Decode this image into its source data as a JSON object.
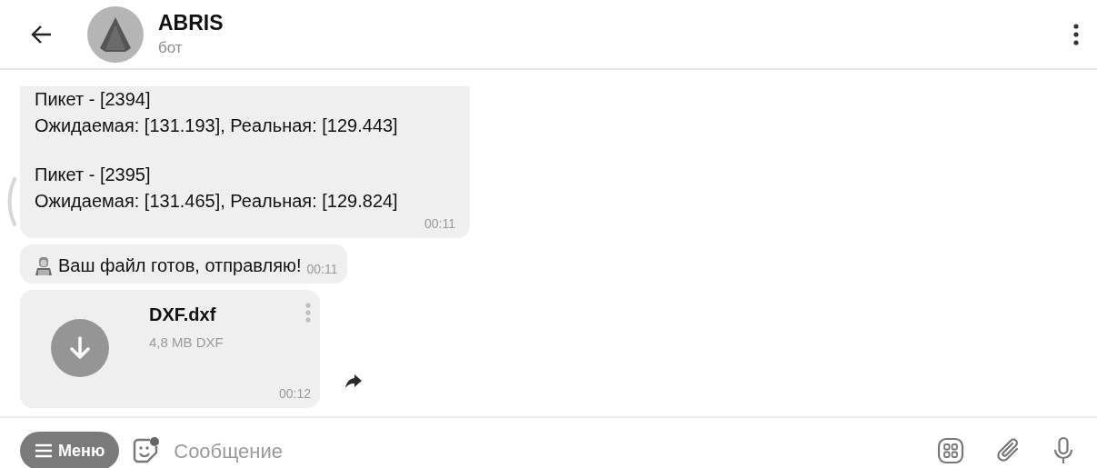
{
  "header": {
    "title": "ABRIS",
    "subtitle": "бот"
  },
  "messages": [
    {
      "kind": "text",
      "paragraphs": [
        "Пикет - [2394]\nОжидаемая: [131.193], Реальная: [129.443]",
        "Пикет - [2395]\nОжидаемая: [131.465], Реальная: [129.824]"
      ],
      "time": "00:11"
    },
    {
      "kind": "inline",
      "text": "Ваш файл готов, отправляю!",
      "time": "00:11"
    },
    {
      "kind": "file",
      "name": "DXF.dxf",
      "meta": "4,8 MB DXF",
      "time": "00:12"
    }
  ],
  "composer": {
    "menu_label": "Меню",
    "placeholder": "Сообщение"
  }
}
